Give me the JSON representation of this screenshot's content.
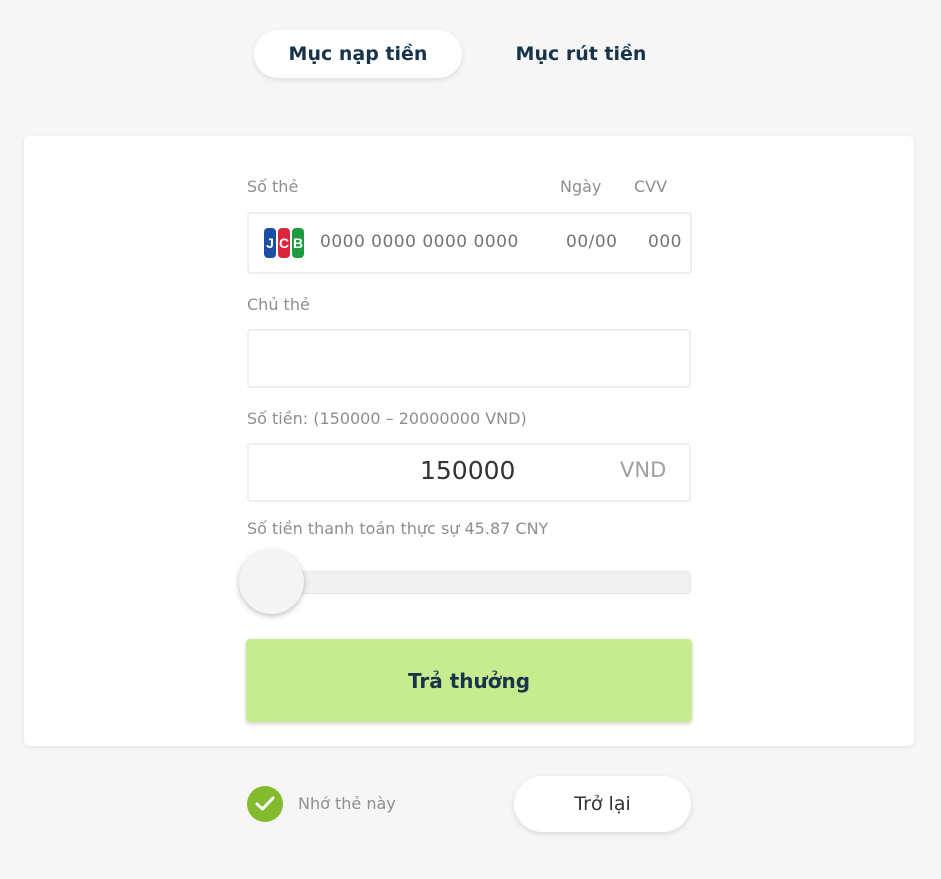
{
  "tabs": {
    "deposit": "Mục nạp tiền",
    "withdraw": "Mục rút tiền"
  },
  "form": {
    "card_number_label": "Số thẻ",
    "date_label": "Ngày",
    "cvv_label": "CVV",
    "card_brand": "jcb-icon",
    "card_number_placeholder": "0000 0000 0000 0000",
    "date_placeholder": "00/00",
    "cvv_placeholder": "000",
    "holder_label": "Chủ thẻ",
    "holder_value": "",
    "amount_label": "Số tiền: (150000 – 20000000 VND)",
    "amount_value": "150000",
    "amount_unit": "VND",
    "actual_payment_text": "Số tiền thanh toán thực sự 45.87 CNY",
    "slider_level": 0,
    "submit_label": "Trả thưởng"
  },
  "footer": {
    "remember_label": "Nhớ thẻ này",
    "remember_checked": true,
    "back_label": "Trở lại"
  },
  "colors": {
    "accent_green": "#c7ec8f",
    "check_green": "#82bc2e",
    "text_dark": "#17344a"
  }
}
